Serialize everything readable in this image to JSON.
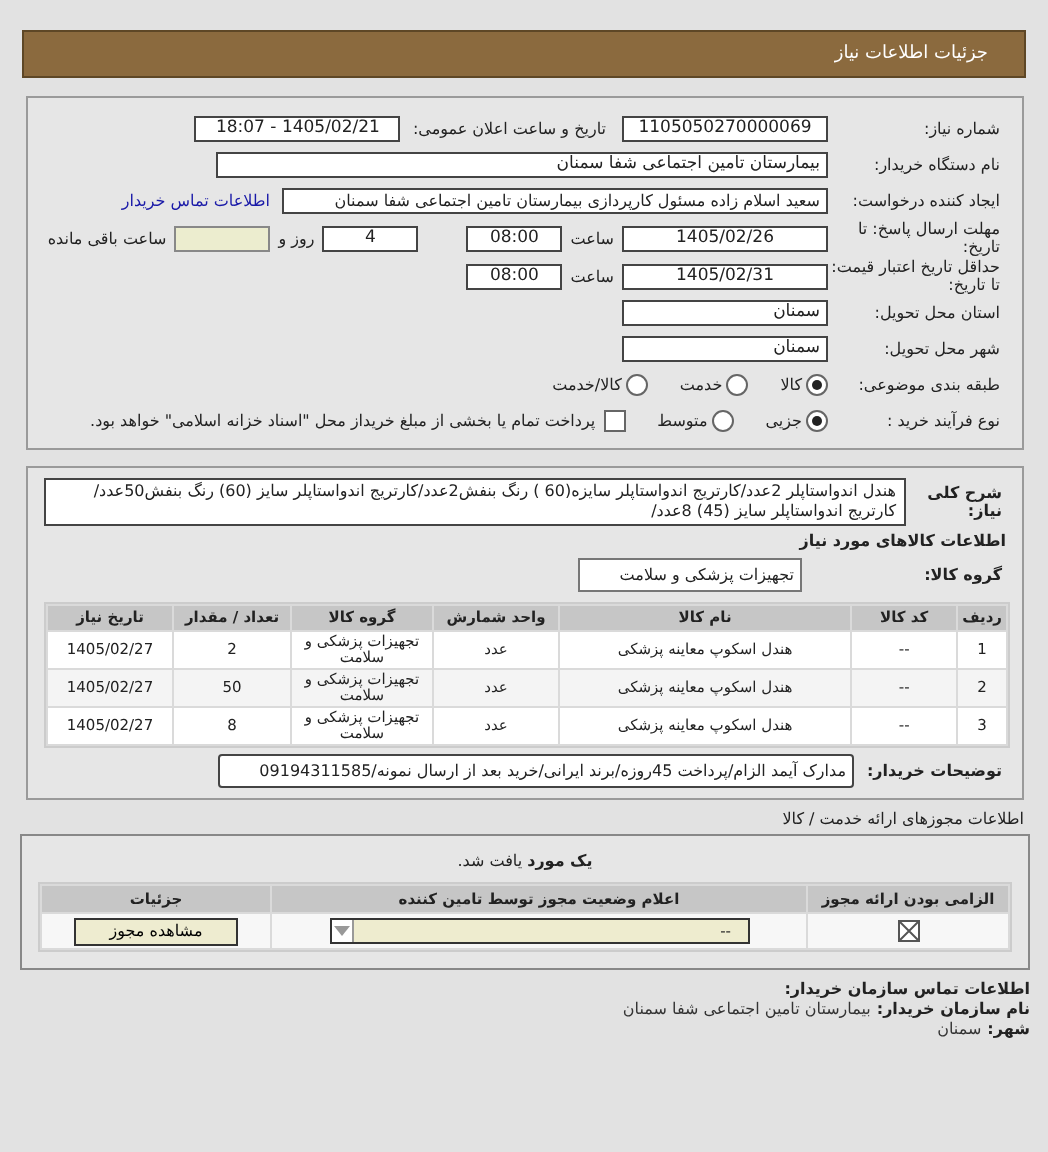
{
  "header": {
    "title": "جزئیات اطلاعات نیاز"
  },
  "details": {
    "need_number": {
      "label": "شماره نیاز:",
      "value": "1105050270000069"
    },
    "announce": {
      "label": "تاریخ و ساعت اعلان عمومی:",
      "value": "1405/02/21 - 18:07"
    },
    "buyer": {
      "label": "نام دستگاه خریدار:",
      "value": "بیمارستان تامین اجتماعی شفا سمنان"
    },
    "creator": {
      "label": "ایجاد کننده درخواست:",
      "value": "سعید اسلام زاده مسئول کارپردازی بیمارستان تامین اجتماعی شفا سمنان",
      "link": "اطلاعات تماس خریدار"
    },
    "deadline": {
      "label": "مهلت ارسال پاسخ: تا تاریخ:",
      "date": "1405/02/26",
      "time_label": "ساعت",
      "time": "08:00",
      "days": "4",
      "days_label": "روز و",
      "remaining_label": "ساعت باقی مانده"
    },
    "validity": {
      "label": "حداقل تاریخ اعتبار قیمت: تا تاریخ:",
      "date": "1405/02/31",
      "time_label": "ساعت",
      "time": "08:00"
    },
    "province": {
      "label": "استان محل تحویل:",
      "value": "سمنان"
    },
    "city": {
      "label": "شهر محل تحویل:",
      "value": "سمنان"
    },
    "category": {
      "label": "طبقه بندی موضوعی:",
      "options": [
        {
          "label": "کالا",
          "selected": true
        },
        {
          "label": "خدمت",
          "selected": false
        },
        {
          "label": "کالا/خدمت",
          "selected": false
        }
      ]
    },
    "process": {
      "label": "نوع فرآیند خرید :",
      "options": [
        {
          "label": "جزیی",
          "selected": true
        },
        {
          "label": "متوسط",
          "selected": false
        }
      ],
      "payment": {
        "checked": false,
        "label": "پرداخت تمام یا بخشی از مبلغ خریداز محل \"اسناد خزانه اسلامی\" خواهد بود."
      }
    }
  },
  "goods": {
    "description": {
      "label": "شرح کلی نیاز:",
      "value": "هندل اندواستاپلر 2عدد/کارتریج اندواستاپلر سایزه(60 ) رنگ بنفش2عدد/کارتریج اندواستاپلر سایز (60) رنگ بنفش50عدد/کارتریج اندواستاپلر سایز (45) 8عدد/"
    },
    "heading": "اطلاعات کالاهای مورد نیاز",
    "group": {
      "label": "گروه کالا:",
      "value": "تجهیزات پزشکی و سلامت"
    },
    "table": {
      "columns": [
        "ردیف",
        "کد کالا",
        "نام کالا",
        "واحد شمارش",
        "گروه کالا",
        "تعداد / مقدار",
        "تاریخ نیاز"
      ],
      "rows": [
        [
          "1",
          "--",
          "هندل اسکوپ معاینه پزشکی",
          "عدد",
          "تجهیزات پزشکی و سلامت",
          "2",
          "1405/02/27"
        ],
        [
          "2",
          "--",
          "هندل اسکوپ معاینه پزشکی",
          "عدد",
          "تجهیزات پزشکی و سلامت",
          "50",
          "1405/02/27"
        ],
        [
          "3",
          "--",
          "هندل اسکوپ معاینه پزشکی",
          "عدد",
          "تجهیزات پزشکی و سلامت",
          "8",
          "1405/02/27"
        ]
      ]
    },
    "buyer_notes": {
      "label": "توضیحات خریدار:",
      "value": "مدارک آیمد الزام/پرداخت 45روزه/برند ایرانی/خرید بعد از ارسال نمونه/09194311585"
    }
  },
  "permits": {
    "heading": "اطلاعات مجوزهای ارائه خدمت / کالا",
    "found": "**یک مورد** یافت شد.",
    "columns": [
      "الزامی بودن ارائه مجوز",
      "اعلام وضعیت مجوز توسط تامین کننده",
      "جزئیات"
    ],
    "rows": [
      {
        "required": false,
        "status": "--",
        "button": "مشاهده مجوز"
      }
    ]
  },
  "contact": {
    "heading": "اطلاعات تماس سازمان خریدار:",
    "org_label": "نام سازمان خریدار:",
    "org": "بیمارستان تامین اجتماعی شفا سمنان",
    "city_label": "شهر:",
    "city": "سمنان"
  }
}
